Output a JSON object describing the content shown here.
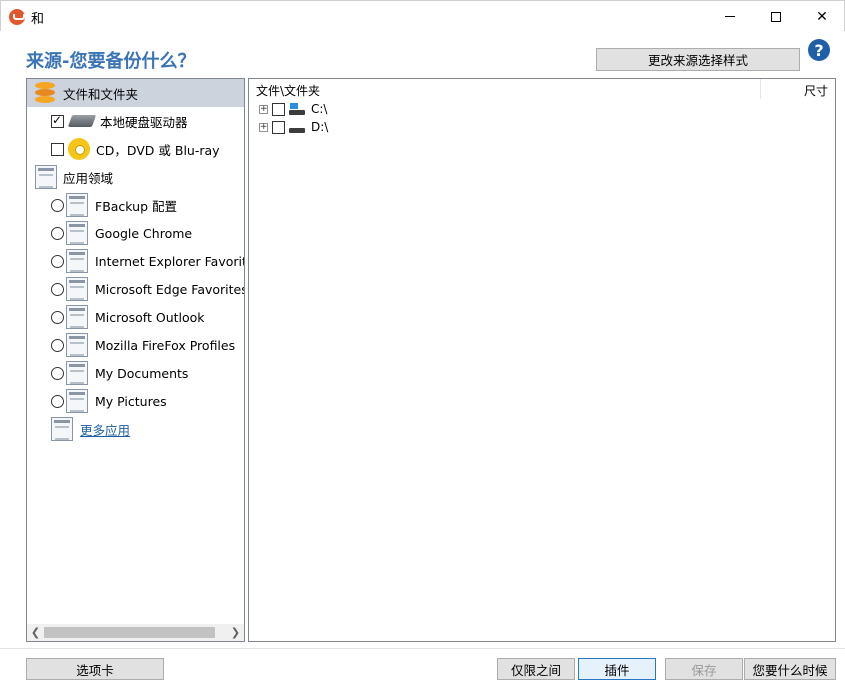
{
  "window": {
    "title": "和"
  },
  "header": {
    "heading": "来源-您要备份什么？",
    "change_style_button": "更改来源选择样式",
    "help_label": "?"
  },
  "left_tree": {
    "items": [
      {
        "label": "文件和文件夹",
        "type": "category",
        "icon": "database-icon",
        "selected": true
      },
      {
        "label": "本地硬盘驱动器",
        "type": "checkbox",
        "checked": true,
        "icon": "hard-drive-icon"
      },
      {
        "label": "CD，DVD 或 Blu-ray",
        "type": "checkbox",
        "checked": false,
        "icon": "cd-icon"
      },
      {
        "label": "应用领域",
        "type": "category",
        "icon": "app-icon"
      },
      {
        "label": "FBackup 配置",
        "type": "radio",
        "icon": "app-icon"
      },
      {
        "label": "Google Chrome",
        "type": "radio",
        "icon": "app-icon"
      },
      {
        "label": "Internet Explorer Favorites",
        "type": "radio",
        "icon": "app-icon"
      },
      {
        "label": "Microsoft Edge Favorites",
        "type": "radio",
        "icon": "app-icon"
      },
      {
        "label": "Microsoft Outlook",
        "type": "radio",
        "icon": "app-icon"
      },
      {
        "label": "Mozilla FireFox Profiles",
        "type": "radio",
        "icon": "app-icon"
      },
      {
        "label": "My Documents",
        "type": "radio",
        "icon": "app-icon"
      },
      {
        "label": "My Pictures",
        "type": "radio",
        "icon": "app-icon"
      }
    ],
    "more_apps_link": "更多应用"
  },
  "file_panel": {
    "col_name": "文件\\文件夹",
    "col_size": "尺寸",
    "drives": [
      {
        "label": "C:\\",
        "icon": "windows-drive-icon"
      },
      {
        "label": "D:\\",
        "icon": "drive-icon"
      }
    ]
  },
  "footer": {
    "tab_button": "选项卡",
    "only_between_button": "仅限之间",
    "plugin_button": "插件",
    "save_button": "保存",
    "when_button": "您要什么时候"
  }
}
